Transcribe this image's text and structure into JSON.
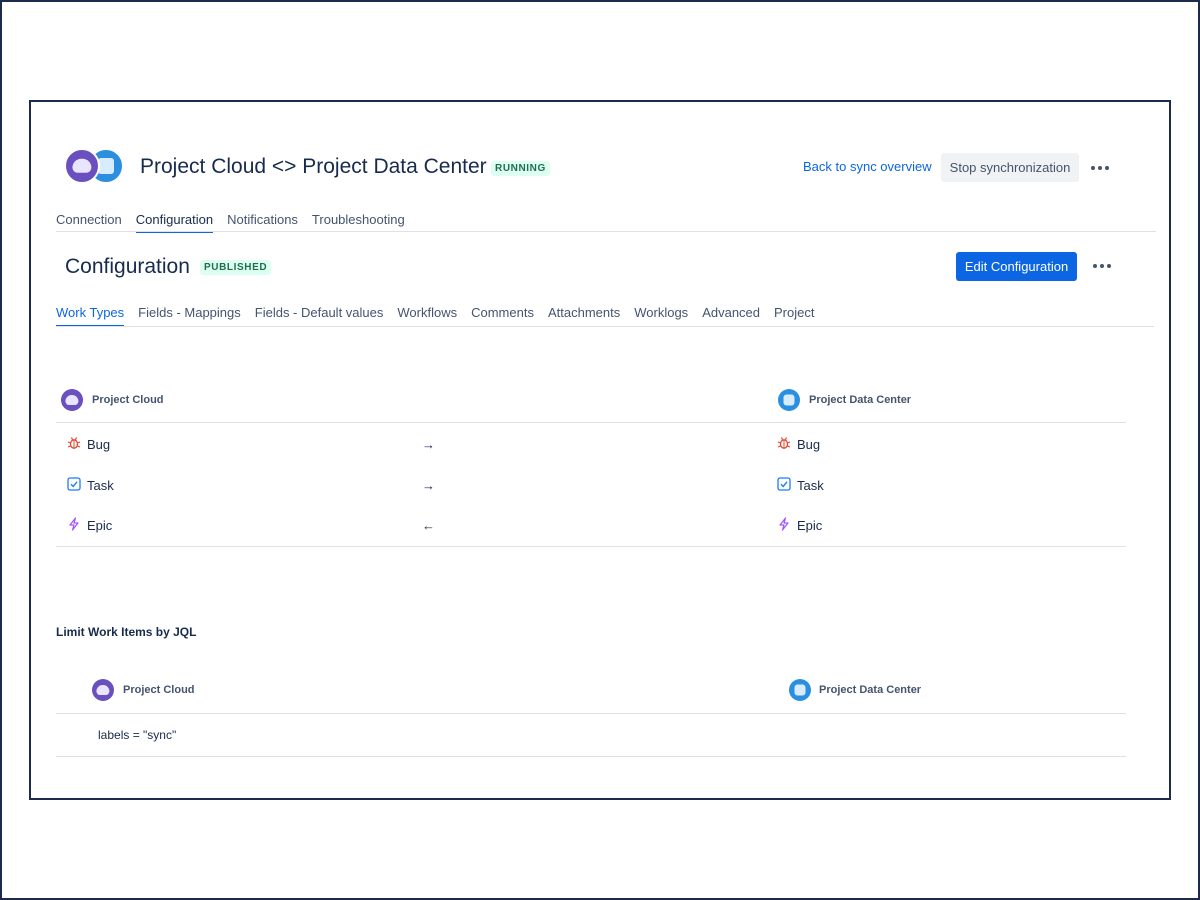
{
  "header": {
    "title": "Project Cloud <> Project Data Center",
    "status_badge": "RUNNING",
    "back_link": "Back to sync overview",
    "stop_button": "Stop synchronization"
  },
  "main_tabs": [
    {
      "label": "Connection",
      "active": false
    },
    {
      "label": "Configuration",
      "active": true
    },
    {
      "label": "Notifications",
      "active": false
    },
    {
      "label": "Troubleshooting",
      "active": false
    }
  ],
  "configuration": {
    "heading": "Configuration",
    "status_badge": "PUBLISHED",
    "edit_button": "Edit Configuration"
  },
  "config_tabs": [
    {
      "label": "Work Types",
      "active": true
    },
    {
      "label": "Fields - Mappings",
      "active": false
    },
    {
      "label": "Fields - Default values",
      "active": false
    },
    {
      "label": "Workflows",
      "active": false
    },
    {
      "label": "Comments",
      "active": false
    },
    {
      "label": "Attachments",
      "active": false
    },
    {
      "label": "Worklogs",
      "active": false
    },
    {
      "label": "Advanced",
      "active": false
    },
    {
      "label": "Project",
      "active": false
    }
  ],
  "work_types": {
    "left_project": "Project Cloud",
    "right_project": "Project Data Center",
    "rows": [
      {
        "left": "Bug",
        "arrow": "→",
        "right": "Bug",
        "icon": "bug-icon"
      },
      {
        "left": "Task",
        "arrow": "→",
        "right": "Task",
        "icon": "task-icon"
      },
      {
        "left": "Epic",
        "arrow": "←",
        "right": "Epic",
        "icon": "epic-icon"
      }
    ]
  },
  "jql": {
    "title": "Limit Work Items by JQL",
    "left_project": "Project Cloud",
    "right_project": "Project Data Center",
    "left_query": "labels = \"sync\""
  },
  "colors": {
    "accent": "#0c66e4",
    "running_bg": "#dcfff1",
    "running_fg": "#216e4e",
    "bug": "#e34935",
    "task": "#1d7afc",
    "epic": "#a054f7",
    "cloud_avatar": "#6a4fbf",
    "dc_avatar": "#2b8fe0"
  }
}
